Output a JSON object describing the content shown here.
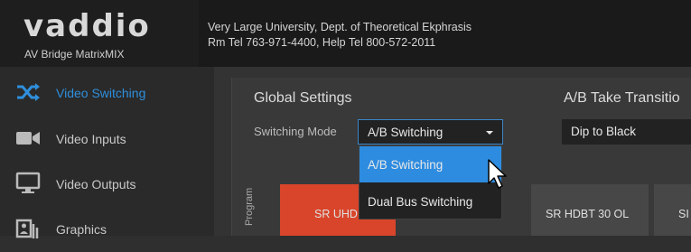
{
  "header": {
    "logo": "vaddio",
    "product": "AV Bridge MatrixMIX",
    "org_line1": "Very Large University, Dept. of Theoretical Ekphrasis",
    "org_line2": "Rm Tel 763-971-4400, Help Tel 800-572-2011"
  },
  "sidebar": {
    "items": [
      {
        "label": "Video Switching",
        "icon": "shuffle-icon",
        "active": true
      },
      {
        "label": "Video Inputs",
        "icon": "video-camera-icon",
        "active": false
      },
      {
        "label": "Video Outputs",
        "icon": "monitor-icon",
        "active": false
      },
      {
        "label": "Graphics",
        "icon": "graphics-icon",
        "active": false
      }
    ]
  },
  "main": {
    "global_settings_title": "Global Settings",
    "ab_take_title": "A/B Take Transitio",
    "switching_mode_label": "Switching Mode",
    "switching_mode_value": "A/B Switching",
    "transition_value": "Dip to Black",
    "dropdown_options": [
      "A/B Switching",
      "Dual Bus Switching"
    ],
    "program_label": "Program",
    "tiles": [
      "SR UHD",
      "SR HDBT 30 OL",
      "SI"
    ]
  },
  "colors": {
    "accent": "#2e8ce0",
    "program_tile": "#d8452a",
    "active_nav": "#2f8fdc"
  }
}
